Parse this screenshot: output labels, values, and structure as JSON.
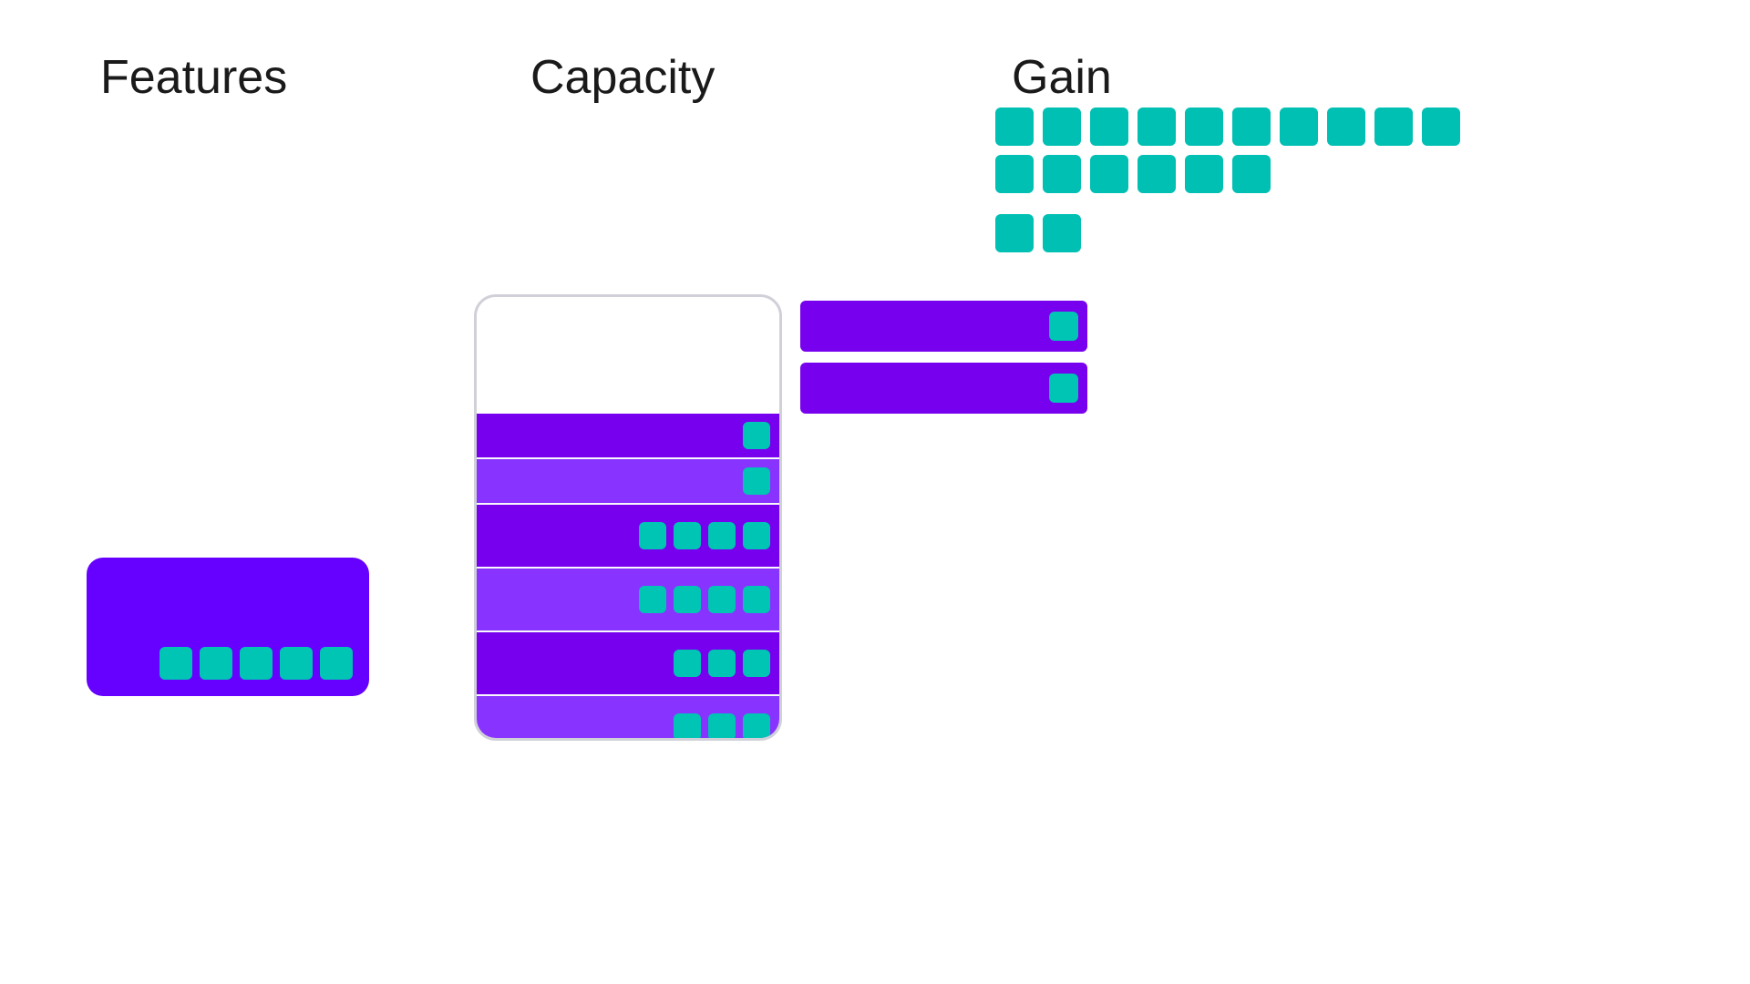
{
  "titles": {
    "features": "Features",
    "capacity": "Capacity",
    "gain": "Gain"
  },
  "feature_block": {
    "dots": 5
  },
  "capacity_bars": [
    {
      "type": "narrow",
      "dots": 1
    },
    {
      "type": "narrow",
      "dots": 1
    },
    {
      "type": "tall",
      "dots": 4
    },
    {
      "type": "tall",
      "dots": 4
    },
    {
      "type": "tall",
      "dots": 3
    },
    {
      "type": "tall",
      "dots": 3
    }
  ],
  "gain_bars": [
    {
      "dots": 1
    },
    {
      "dots": 1
    }
  ],
  "gain_teal_grid": {
    "row1_count": 10,
    "row2_count": 6
  },
  "gain_teal_pair_count": 2
}
